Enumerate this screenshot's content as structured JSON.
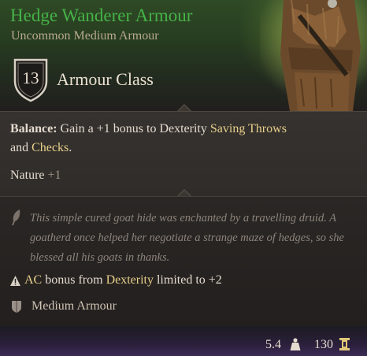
{
  "item": {
    "name": "Hedge Wanderer Armour",
    "subtitle": "Uncommon Medium Armour",
    "name_color": "#46b348"
  },
  "armour_class": {
    "value": "13",
    "label": "Armour Class",
    "icon": "shield-icon"
  },
  "properties": {
    "balance": {
      "label": "Balance:",
      "text_1": "Gain a +1 bonus to Dexterity",
      "keyword_1": "Saving Throws",
      "text_2": "and",
      "keyword_2": "Checks",
      "text_3": "."
    },
    "nature": {
      "label": "Nature",
      "bonus": "+1"
    }
  },
  "description": {
    "icon": "quill-icon",
    "flavor_text": "This simple cured goat hide was enchanted by a travelling druid. A goatherd once helped her negotiate a strange maze of hedges, so she blessed all his goats in thanks."
  },
  "restriction": {
    "icon": "warning-icon",
    "keyword_1": "AC",
    "text_1": "bonus from",
    "keyword_2": "Dexterity",
    "text_2": "limited to +2"
  },
  "armour_type": {
    "icon": "armour-icon",
    "label": "Medium Armour"
  },
  "footer": {
    "weight": "5.4",
    "weight_icon": "weight-icon",
    "price": "130",
    "price_icon": "gold-coin-icon"
  },
  "colors": {
    "keyword": "#e7cf8a",
    "body_text": "#e4dace",
    "flavor_text": "#8d847b"
  }
}
